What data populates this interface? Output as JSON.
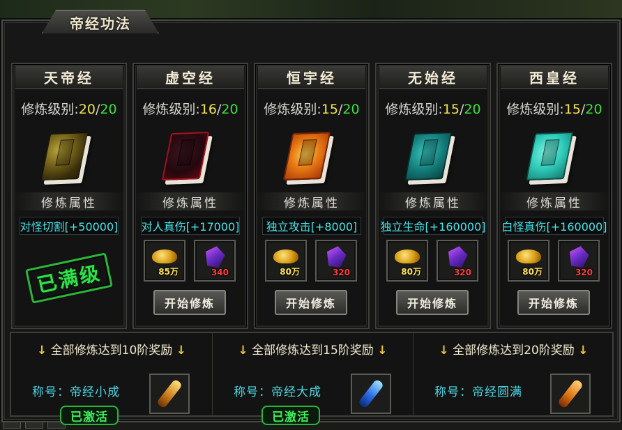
{
  "window": {
    "title": "帝经功法"
  },
  "colors": {
    "accent_gold": "#f6e34a",
    "accent_green": "#3be23b",
    "accent_cyan": "#43e6ec",
    "stamp_green": "#2ee24a"
  },
  "books": [
    {
      "name": "天帝经",
      "level_label": "修炼级别:",
      "level_current": "20",
      "level_sep": "/",
      "level_max": "20",
      "attr_label": "修炼属性",
      "attr_value": "对怪切割[+50000]",
      "maxed": true,
      "max_label": "已满级",
      "cover_icon": "book-gold-icon"
    },
    {
      "name": "虚空经",
      "level_label": "修炼级别:",
      "level_current": "16",
      "level_sep": "/",
      "level_max": "20",
      "attr_label": "修炼属性",
      "attr_value": "对人真伤[+17000]",
      "maxed": false,
      "gold_qty": "85万",
      "gem_qty": "340",
      "button": "开始修炼",
      "cover_icon": "book-red-icon"
    },
    {
      "name": "恒宇经",
      "level_label": "修炼级别:",
      "level_current": "15",
      "level_sep": "/",
      "level_max": "20",
      "attr_label": "修炼属性",
      "attr_value": "独立攻击[+8000]",
      "maxed": false,
      "gold_qty": "80万",
      "gem_qty": "320",
      "button": "开始修炼",
      "cover_icon": "book-orange-icon"
    },
    {
      "name": "无始经",
      "level_label": "修炼级别:",
      "level_current": "15",
      "level_sep": "/",
      "level_max": "20",
      "attr_label": "修炼属性",
      "attr_value": "独立生命[+160000]",
      "maxed": false,
      "gold_qty": "80万",
      "gem_qty": "320",
      "button": "开始修炼",
      "cover_icon": "book-teal-icon"
    },
    {
      "name": "西皇经",
      "level_label": "修炼级别:",
      "level_current": "15",
      "level_sep": "/",
      "level_max": "20",
      "attr_label": "修炼属性",
      "attr_value": "白怪真伤[+160000]",
      "maxed": false,
      "gold_qty": "80万",
      "gem_qty": "320",
      "button": "开始修炼",
      "cover_icon": "book-cyan-icon"
    }
  ],
  "rewards": [
    {
      "arrow": "↓",
      "header": "全部修炼达到10阶奖励",
      "title": "称号：帝经小成",
      "activated": "已激活",
      "icon": "golden-scroll-icon"
    },
    {
      "arrow": "↓",
      "header": "全部修炼达到15阶奖励",
      "title": "称号：帝经大成",
      "activated": "已激活",
      "icon": "blue-scroll-icon"
    },
    {
      "arrow": "↓",
      "header": "全部修炼达到20阶奖励",
      "title": "称号：帝经圆满",
      "activated": "",
      "icon": "orange-scroll-icon"
    }
  ]
}
